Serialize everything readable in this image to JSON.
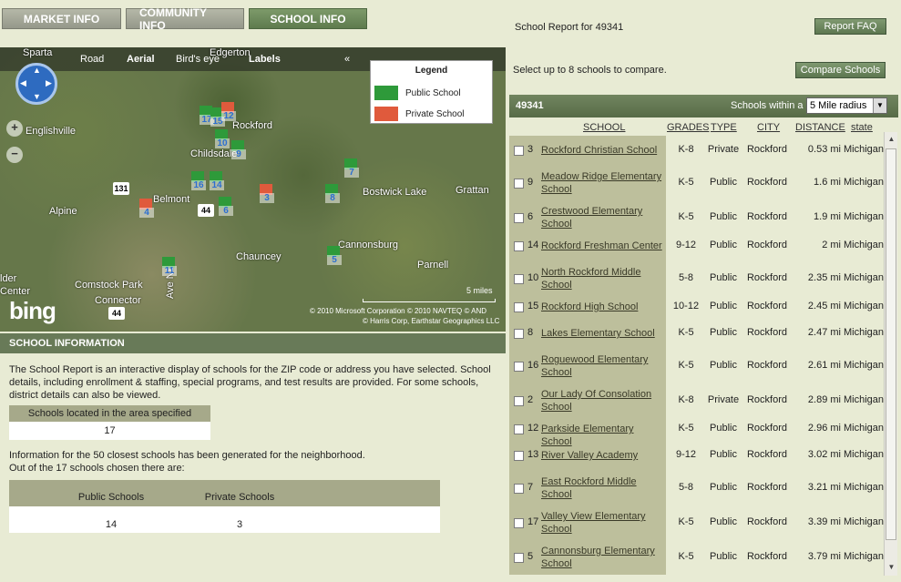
{
  "tabs": [
    "MARKET INFO",
    "COMMUNITY INFO",
    "SCHOOL INFO"
  ],
  "report_title": "School Report for 49341",
  "report_faq": "Report FAQ",
  "select_note": "Select up to 8 schools to compare.",
  "compare_button": "Compare Schools",
  "map": {
    "nav": [
      "Road",
      "Aerial",
      "Bird's eye",
      "Labels"
    ],
    "collapse": "«",
    "legend_title": "Legend",
    "legend_public": "Public School",
    "legend_private": "Private School",
    "zoom_in": "+",
    "zoom_out": "−",
    "logo": "bing",
    "scale": "5 miles",
    "copyright1": "© 2010 Microsoft Corporation   © 2010 NAVTEQ   © AND",
    "copyright2": "© Harris Corp, Earthstar Geographics LLC",
    "towns": [
      "Sparta",
      "Edgerton",
      "Englishville",
      "Rockford",
      "Childsdale",
      "Belmont",
      "Alpine",
      "Bostwick Lake",
      "Grattan",
      "Cannonsburg",
      "Parnell",
      "Chauncey",
      "Comstock Park",
      "Connector",
      "Ave NE",
      "lder",
      "Center"
    ],
    "highways": [
      "131",
      "44",
      "44"
    ],
    "markers": [
      "17",
      "15",
      "12",
      "2",
      "10",
      "9",
      "16",
      "14",
      "4",
      "6",
      "3",
      "8",
      "7",
      "5",
      "11"
    ],
    "public_color": "#2e9a3a",
    "private_color": "#e05a3c"
  },
  "info": {
    "header": "SCHOOL INFORMATION",
    "text": "The School Report is an interactive display of schools for the ZIP code or address you have selected. School details, including enrollment & staffing, special programs, and test results are provided. For some schools, district details can also be viewed.",
    "located_label": "Schools located in the area specified",
    "located_value": "17",
    "line1": "Information for the 50 closest schools has been generated for the neighborhood.",
    "line2": "Out of the 17 schools chosen there are:",
    "public_label": "Public Schools",
    "private_label": "Private Schools",
    "public_value": "14",
    "private_value": "3"
  },
  "results": {
    "zip": "49341",
    "within_label": "Schools within a",
    "radius": "5 Mile radius",
    "columns": [
      "SCHOOL",
      "GRADES",
      "TYPE",
      "CITY",
      "DISTANCE",
      "state"
    ],
    "rows": [
      {
        "num": "3",
        "name": "Rockford Christian School",
        "grades": "K-8",
        "type": "Private",
        "city": "Rockford",
        "distance": "0.53 mi",
        "state": "Michigan"
      },
      {
        "num": "9",
        "name": "Meadow Ridge Elementary School",
        "grades": "K-5",
        "type": "Public",
        "city": "Rockford",
        "distance": "1.6 mi",
        "state": "Michigan"
      },
      {
        "num": "6",
        "name": "Crestwood Elementary School",
        "grades": "K-5",
        "type": "Public",
        "city": "Rockford",
        "distance": "1.9 mi",
        "state": "Michigan"
      },
      {
        "num": "14",
        "name": "Rockford Freshman Center",
        "grades": "9-12",
        "type": "Public",
        "city": "Rockford",
        "distance": "2 mi",
        "state": "Michigan"
      },
      {
        "num": "10",
        "name": "North Rockford Middle School",
        "grades": "5-8",
        "type": "Public",
        "city": "Rockford",
        "distance": "2.35 mi",
        "state": "Michigan"
      },
      {
        "num": "15",
        "name": "Rockford High School",
        "grades": "10-12",
        "type": "Public",
        "city": "Rockford",
        "distance": "2.45 mi",
        "state": "Michigan"
      },
      {
        "num": "8",
        "name": "Lakes Elementary School",
        "grades": "K-5",
        "type": "Public",
        "city": "Rockford",
        "distance": "2.47 mi",
        "state": "Michigan"
      },
      {
        "num": "16",
        "name": "Roguewood Elementary School",
        "grades": "K-5",
        "type": "Public",
        "city": "Rockford",
        "distance": "2.61 mi",
        "state": "Michigan"
      },
      {
        "num": "2",
        "name": "Our Lady Of Consolation School",
        "grades": "K-8",
        "type": "Private",
        "city": "Rockford",
        "distance": "2.89 mi",
        "state": "Michigan"
      },
      {
        "num": "12",
        "name": "Parkside Elementary School",
        "grades": "K-5",
        "type": "Public",
        "city": "Rockford",
        "distance": "2.96 mi",
        "state": "Michigan"
      },
      {
        "num": "13",
        "name": "River Valley Academy",
        "grades": "9-12",
        "type": "Public",
        "city": "Rockford",
        "distance": "3.02 mi",
        "state": "Michigan"
      },
      {
        "num": "7",
        "name": "East Rockford Middle School",
        "grades": "5-8",
        "type": "Public",
        "city": "Rockford",
        "distance": "3.21 mi",
        "state": "Michigan"
      },
      {
        "num": "17",
        "name": "Valley View Elementary School",
        "grades": "K-5",
        "type": "Public",
        "city": "Rockford",
        "distance": "3.39 mi",
        "state": "Michigan"
      },
      {
        "num": "5",
        "name": "Cannonsburg Elementary School",
        "grades": "K-5",
        "type": "Public",
        "city": "Rockford",
        "distance": "3.79 mi",
        "state": "Michigan"
      }
    ]
  }
}
